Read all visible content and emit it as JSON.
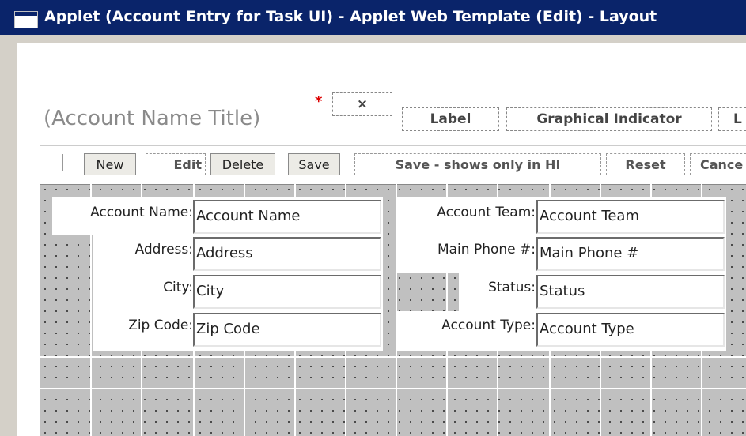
{
  "window": {
    "title": "Applet (Account Entry for Task UI) - Applet Web Template (Edit) - Layout"
  },
  "header": {
    "account_title": "(Account Name Title)",
    "required_marker": "*",
    "close_glyph": "×",
    "label_ctrl": "Label",
    "graphical_indicator": "Graphical Indicator",
    "trailing_ctrl": "L"
  },
  "toolbar": {
    "new": "New",
    "edit": "Edit",
    "delete": "Delete",
    "save": "Save",
    "save_hi": "Save - shows only in HI",
    "reset": "Reset",
    "cancel": "Cance"
  },
  "form": {
    "left": [
      {
        "label": "Account Name:",
        "value": "Account Name"
      },
      {
        "label": "Address:",
        "value": "Address"
      },
      {
        "label": "City:",
        "value": "City"
      },
      {
        "label": "Zip Code:",
        "value": "Zip Code"
      }
    ],
    "right": [
      {
        "label": "Account Team:",
        "value": "Account Team"
      },
      {
        "label": "Main Phone #:",
        "value": "Main Phone #"
      },
      {
        "label": "Status:",
        "value": "Status"
      },
      {
        "label": "Account Type:",
        "value": "Account Type"
      }
    ]
  },
  "colors": {
    "titlebar": "#0a246a",
    "window": "#d4d0c8",
    "grid": "#c0c0c0",
    "required": "#dd0000"
  }
}
